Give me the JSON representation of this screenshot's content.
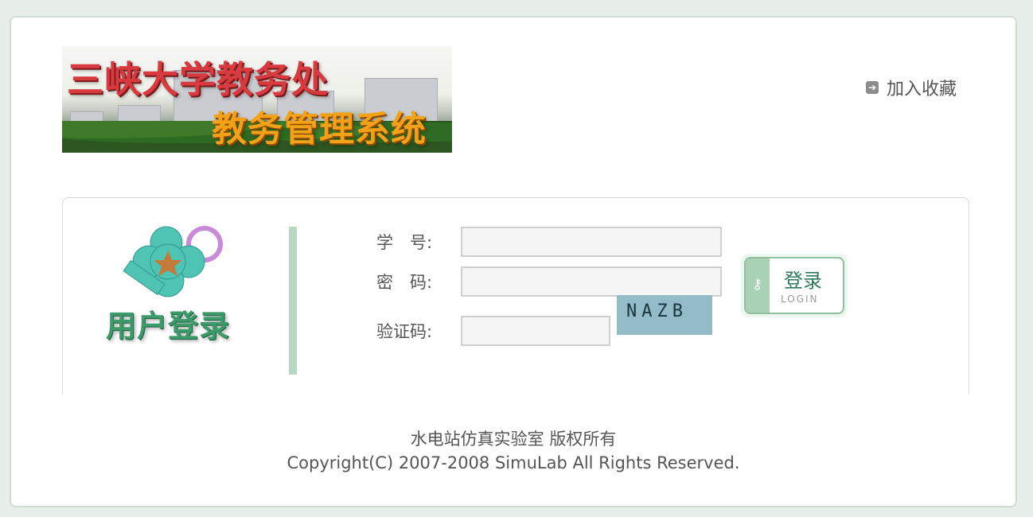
{
  "header": {
    "banner_title": "三峡大学教务处",
    "banner_subtitle": "教务管理系统",
    "bookmark_label": "加入收藏"
  },
  "login": {
    "caption": "用户登录",
    "student_id_label": "学　号:",
    "password_label": "密　码:",
    "captcha_label": "验证码:",
    "student_id_value": "",
    "password_value": "",
    "captcha_value": "",
    "captcha_text": "NAZB",
    "button_cn": "登录",
    "button_en": "LOGIN"
  },
  "footer": {
    "line1": "水电站仿真实验室 版权所有",
    "line2": "Copyright(C) 2007-2008 SimuLab All Rights Reserved."
  }
}
